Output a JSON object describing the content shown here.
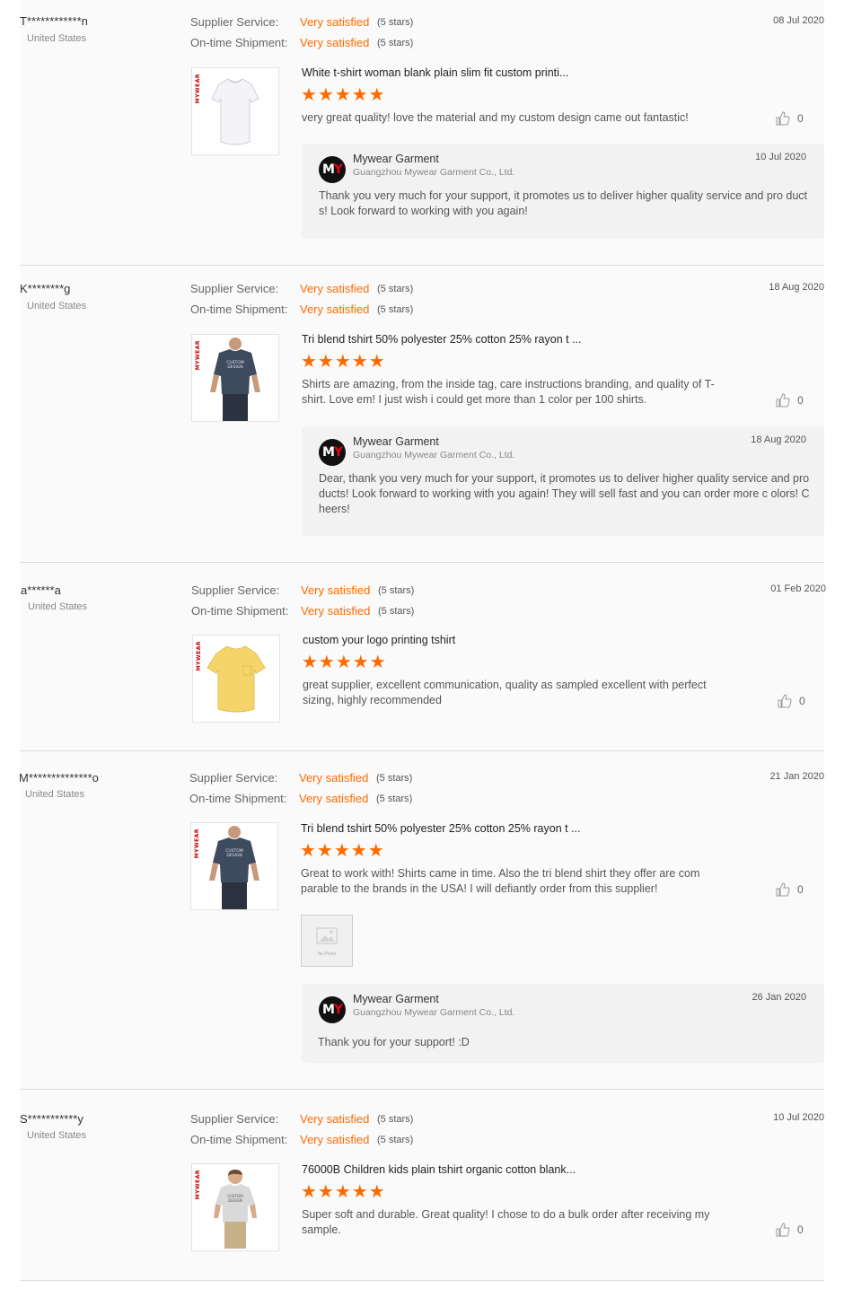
{
  "labels": {
    "supplier_service": "Supplier Service:",
    "on_time_shipment": "On-time Shipment:",
    "five_stars": "(5 stars)"
  },
  "stars_glyphs": "★★★★★",
  "brand_mark": "MYWEAR",
  "reviews": [
    {
      "buyer": "T************n",
      "country": "United States",
      "supplier_service": "Very satisfied",
      "on_time_shipment": "Very satisfied",
      "date": "08 Jul 2020",
      "product_title": "White t-shirt woman blank plain slim fit custom printi...",
      "rating_stars": 5,
      "comment": "very great quality! love the material and my custom design came out fantastic!",
      "likes": "0",
      "reply": {
        "seller": "Mywear Garment",
        "company": "Guangzhou Mywear Garment Co., Ltd.",
        "date": "10 Jul 2020",
        "text": "Thank you very much for your support, it promotes us to deliver higher quality service and pro ducts! Look forward to working with you again!"
      }
    },
    {
      "buyer": "K********g",
      "country": "United States",
      "supplier_service": "Very satisfied",
      "on_time_shipment": "Very satisfied",
      "date": "18 Aug 2020",
      "product_title": "Tri blend tshirt 50% polyester 25% cotton 25% rayon t ...",
      "rating_stars": 5,
      "comment": "Shirts are amazing, from the inside tag, care instructions branding, and quality of T-shirt. Love em! I just wish i could get more than 1 color per 100 shirts.",
      "likes": "0",
      "reply": {
        "seller": "Mywear Garment",
        "company": "Guangzhou Mywear Garment Co., Ltd.",
        "date": "18 Aug 2020",
        "text": "Dear, thank you very much for your support, it promotes us to deliver higher quality service and products! Look forward to working with you again! They will sell fast and you can order more c olors! Cheers!"
      }
    },
    {
      "buyer": "a******a",
      "country": "United States",
      "supplier_service": "Very satisfied",
      "on_time_shipment": "Very satisfied",
      "date": "01 Feb 2020",
      "product_title": "custom your logo printing tshirt",
      "rating_stars": 5,
      "comment": "great supplier, excellent communication, quality as sampled excellent with perfect sizing, highly recommended",
      "likes": "0"
    },
    {
      "buyer": "M**************o",
      "country": "United States",
      "supplier_service": "Very satisfied",
      "on_time_shipment": "Very satisfied",
      "date": "21 Jan 2020",
      "product_title": "Tri blend tshirt 50% polyester 25% cotton 25% rayon t ...",
      "rating_stars": 5,
      "comment": "Great to work with! Shirts came in time. Also the tri blend shirt they offer are com parable to the brands in the USA! I will defiantly order from this supplier!",
      "likes": "0",
      "attachment_placeholder": "No Photo",
      "reply": {
        "seller": "Mywear Garment",
        "company": "Guangzhou Mywear Garment Co., Ltd.",
        "date": "26 Jan 2020",
        "text": "Thank you for your support!  :D"
      }
    },
    {
      "buyer": "S***********y",
      "country": "United States",
      "supplier_service": "Very satisfied",
      "on_time_shipment": "Very satisfied",
      "date": "10 Jul 2020",
      "product_title": "76000B Children kids plain tshirt organic cotton blank...",
      "rating_stars": 5,
      "comment": "Super soft and durable. Great quality! I chose to do a bulk order after receiving my sample.",
      "likes": "0"
    }
  ],
  "thumb_text": {
    "custom_design_top": "CUSTOM",
    "custom_design_bottom": "DESIGN"
  },
  "colors": {
    "accent": "#ff6a00",
    "logo_red": "#e60012",
    "white_shirt": "#f4f4f8",
    "grey_shirt": "#3e4a5e",
    "yellow_shirt": "#f5d56a",
    "kid_shirt": "#d9d9d9"
  },
  "seller_logo": {
    "m": "M",
    "y": "Y"
  }
}
